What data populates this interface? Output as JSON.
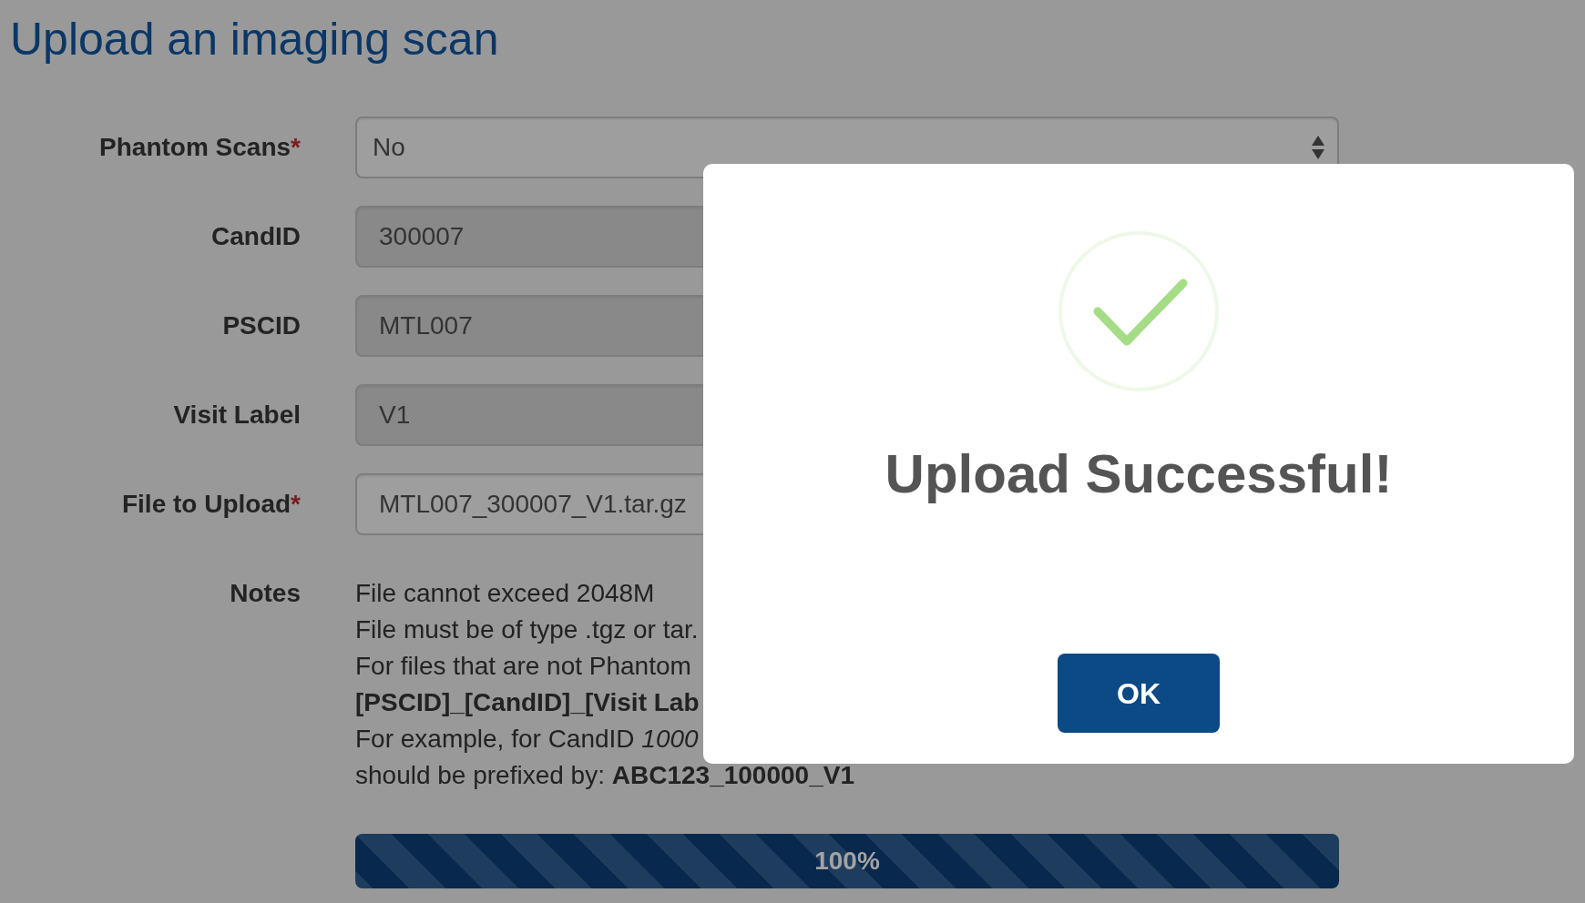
{
  "page": {
    "title": "Upload an imaging scan"
  },
  "form": {
    "fields": [
      {
        "label": "Phantom Scans",
        "required_mark": "*",
        "kind": "select",
        "value": "No",
        "disabled": false
      },
      {
        "label": "CandID",
        "kind": "text",
        "value": "300007",
        "disabled": true
      },
      {
        "label": "PSCID",
        "kind": "text",
        "value": "MTL007",
        "disabled": true
      },
      {
        "label": "Visit Label",
        "kind": "text",
        "value": "V1",
        "disabled": true
      },
      {
        "label": "File to Upload",
        "required_mark": "*",
        "kind": "text",
        "value": "MTL007_300007_V1.tar.gz",
        "disabled": false
      }
    ],
    "notes": {
      "label": "Notes",
      "lines": [
        {
          "kind": "plain",
          "text": "File cannot exceed 2048M"
        },
        {
          "kind": "plain",
          "text": "File must be of type .tgz or tar."
        },
        {
          "kind": "plain",
          "text": "For files that are not Phantom"
        },
        {
          "kind": "pattern",
          "text": "[PSCID]_[CandID]_[Visit Lab"
        },
        {
          "kind": "plain",
          "text": "For example, for CandID *1000*"
        },
        {
          "kind": "plain",
          "text": "should be prefixed by: **ABC123_100000_V1**"
        }
      ]
    }
  },
  "progress": {
    "level": 1,
    "text": "100%"
  },
  "dialog": {
    "title": "Upload Successful!",
    "button": "OK"
  }
}
